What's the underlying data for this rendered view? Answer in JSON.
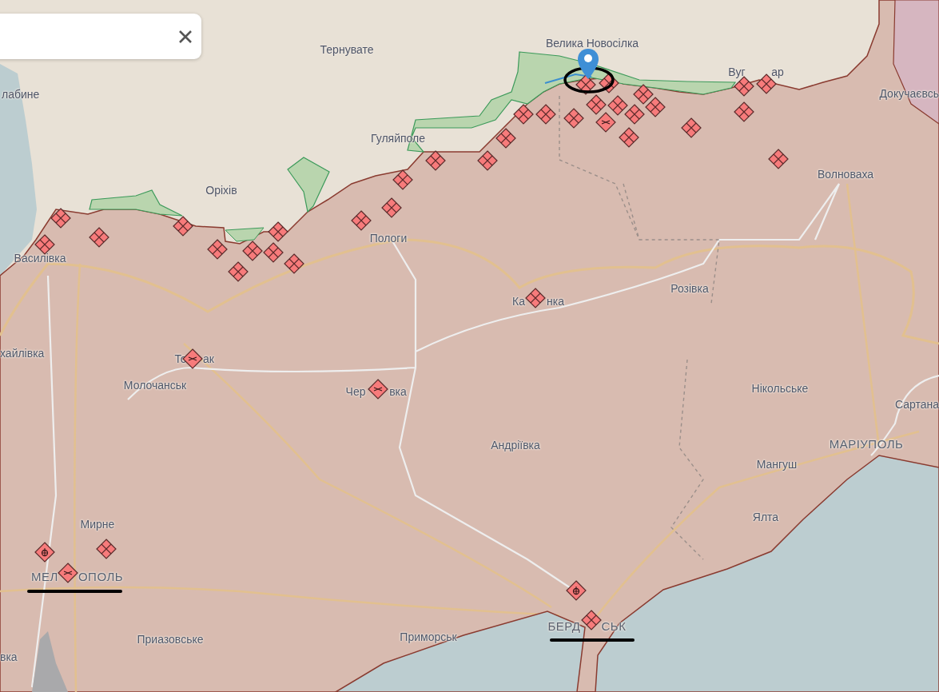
{
  "map": {
    "labels": [
      {
        "text": "Велика Новосілка",
        "kind": "town"
      },
      {
        "text": "Тернувате",
        "kind": "town"
      },
      {
        "text": "лабине",
        "kind": "town"
      },
      {
        "text": "Гуляйполе",
        "kind": "town"
      },
      {
        "text": "Оріхів",
        "kind": "town"
      },
      {
        "text": "Вуг",
        "kind": "town"
      },
      {
        "text": "ар",
        "kind": "town"
      },
      {
        "text": "Докучаєвсь",
        "kind": "town"
      },
      {
        "text": "Волноваха",
        "kind": "town"
      },
      {
        "text": "Василівка",
        "kind": "town"
      },
      {
        "text": "Пологи",
        "kind": "town"
      },
      {
        "text": "Ка",
        "kind": "town"
      },
      {
        "text": "нка",
        "kind": "town"
      },
      {
        "text": "Розівка",
        "kind": "town"
      },
      {
        "text": "хайлівка",
        "kind": "town"
      },
      {
        "text": "То",
        "kind": "town"
      },
      {
        "text": "ак",
        "kind": "town"
      },
      {
        "text": "Молочанськ",
        "kind": "town"
      },
      {
        "text": "Чер",
        "kind": "town"
      },
      {
        "text": "вка",
        "kind": "town"
      },
      {
        "text": "Нікольське",
        "kind": "town"
      },
      {
        "text": "Сартана",
        "kind": "town"
      },
      {
        "text": "Андріївка",
        "kind": "town"
      },
      {
        "text": "МАРІУПОЛЬ",
        "kind": "city"
      },
      {
        "text": "Мангуш",
        "kind": "town"
      },
      {
        "text": "Ялта",
        "kind": "town"
      },
      {
        "text": "Мирне",
        "kind": "town"
      },
      {
        "text": "МЕЛ",
        "kind": "city"
      },
      {
        "text": "ОПОЛЬ",
        "kind": "city"
      },
      {
        "text": "Приазовське",
        "kind": "town"
      },
      {
        "text": "Приморськ",
        "kind": "town"
      },
      {
        "text": "БЕРД",
        "kind": "city"
      },
      {
        "text": "СЬК",
        "kind": "city"
      },
      {
        "text": "вка",
        "kind": "town"
      }
    ]
  }
}
